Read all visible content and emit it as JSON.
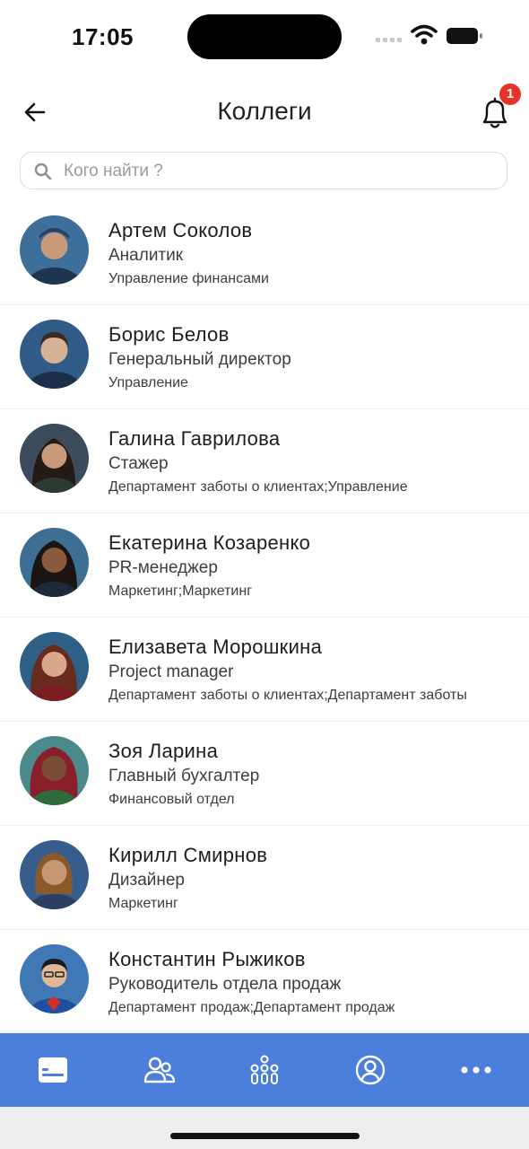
{
  "status_bar": {
    "time": "17:05"
  },
  "header": {
    "title": "Коллеги",
    "notification_count": "1"
  },
  "search": {
    "placeholder": "Кого найти ?"
  },
  "colleagues": [
    {
      "name": "Артем Соколов",
      "role": "Аналитик",
      "department": "Управление финансами",
      "avatar_bg": "#3e6f9a",
      "avatar_skin": "#c99a79"
    },
    {
      "name": "Борис Белов",
      "role": "Генеральный директор",
      "department": "Управление",
      "avatar_bg": "#2f5b86",
      "avatar_skin": "#d7b297"
    },
    {
      "name": "Галина Гаврилова",
      "role": "Стажер",
      "department": "Департамент заботы о клиентах;Управление",
      "avatar_bg": "#3b4b5c",
      "avatar_skin": "#c99a7a"
    },
    {
      "name": "Екатерина Козаренко",
      "role": "PR-менеджер",
      "department": "Маркетинг;Маркетинг",
      "avatar_bg": "#3d6e93",
      "avatar_skin": "#8a5a3f"
    },
    {
      "name": "Елизавета Морошкина",
      "role": "Project manager",
      "department": "Департамент заботы о клиентах;Департамент заботы",
      "avatar_bg": "#2e5f86",
      "avatar_skin": "#d9a98c"
    },
    {
      "name": "Зоя Ларина",
      "role": "Главный бухгалтер",
      "department": "Финансовый отдел",
      "avatar_bg": "#4b8a8a",
      "avatar_skin": "#7b4d35"
    },
    {
      "name": "Кирилл Смирнов",
      "role": "Дизайнер",
      "department": "Маркетинг",
      "avatar_bg": "#365d8c",
      "avatar_skin": "#c89874"
    },
    {
      "name": "Константин Рыжиков",
      "role": "Руководитель отдела продаж",
      "department": "Департамент продаж;Департамент продаж",
      "avatar_bg": "#3f78b5",
      "avatar_skin": "#e0b898"
    }
  ],
  "bottom_nav": [
    {
      "icon": "news-card-icon"
    },
    {
      "icon": "colleagues-icon"
    },
    {
      "icon": "org-structure-icon"
    },
    {
      "icon": "profile-icon"
    },
    {
      "icon": "more-dots-icon"
    }
  ],
  "colors": {
    "accent": "#4c7fdc",
    "badge": "#e5332a"
  }
}
